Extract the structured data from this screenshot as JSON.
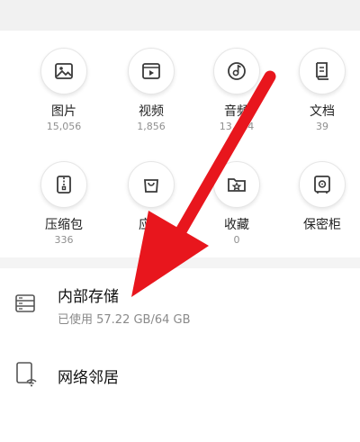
{
  "categories": [
    {
      "label": "图片",
      "count": "15,056",
      "icon": "image-icon"
    },
    {
      "label": "视频",
      "count": "1,856",
      "icon": "video-icon"
    },
    {
      "label": "音频",
      "count": "13,664",
      "icon": "music-icon"
    },
    {
      "label": "文档",
      "count": "39",
      "icon": "document-icon"
    },
    {
      "label": "压缩包",
      "count": "336",
      "icon": "zip-icon"
    },
    {
      "label": "应用",
      "count": "",
      "icon": "app-bag-icon"
    },
    {
      "label": "收藏",
      "count": "0",
      "icon": "star-folder-icon"
    },
    {
      "label": "保密柜",
      "count": "",
      "icon": "safe-icon"
    }
  ],
  "storage": {
    "title": "内部存储",
    "usage": "已使用 57.22 GB/64 GB",
    "icon": "storage-icon"
  },
  "network": {
    "title": "网络邻居",
    "icon": "network-neighbor-icon"
  },
  "colors": {
    "arrow": "#e8161d",
    "icon_stroke": "#3a3a3a"
  }
}
